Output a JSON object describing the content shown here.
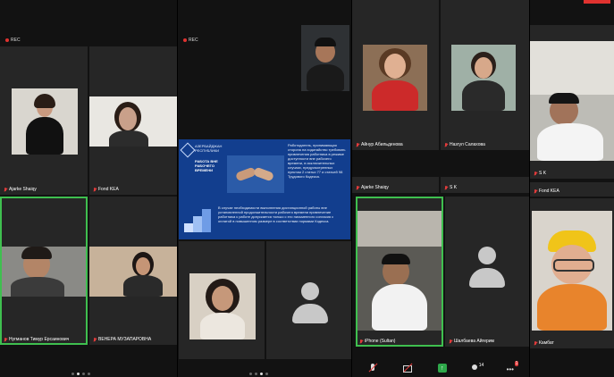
{
  "recording": {
    "label": "REC"
  },
  "panel1": {
    "tiles": [
      {
        "name": "Ajarke Shaiqy"
      },
      {
        "name": "Fond KEA"
      },
      {
        "name": "Нугманов Тимур Ерсаинович"
      },
      {
        "name": "ВЕНЕРА МУЗАПАРОВНА"
      }
    ]
  },
  "panel2": {
    "slide": {
      "logo_text": "АЗЕРБАЙДЖАН\nРЕСПУБЛИКИ",
      "sub_title": "РАБОТА ВНЕ РАБОЧЕГО ВРЕМЕНИ",
      "bullet_top": "Работодатель, принимающая сторона на ходатайство требовать привлечения работника в режиме доступности вне рабочего времени, в исключительных случаях, предусмотренных пунктом 2 статьи 77 и статьей 98 Трудового Кодекса.",
      "bullet_bottom": "В случае необходимости выполнения дистанционной работы вне установленной продолжительности рабочего времени привлечение работника к работе допускается только с его письменного согласия с оплатой в повышенном размере в соответствии нормами Кодекса."
    }
  },
  "panel3": {
    "tiles": [
      {
        "name": "Айнур Абильденова"
      },
      {
        "name": "Назгул Салахова"
      },
      {
        "name": "Ajarke Shaiqy"
      },
      {
        "name": "S K"
      },
      {
        "name": "iPhone (Sultan)"
      },
      {
        "name": "Шалбаева Айгерим"
      }
    ],
    "participants_count": "14",
    "chat_badge": "1"
  },
  "panel4": {
    "tiles": [
      {
        "name": "S K"
      },
      {
        "name": "Fond KEA"
      },
      {
        "name": "Камбат"
      }
    ]
  },
  "colors": {
    "active_outline": "#3fbf4f",
    "slide_bg": "#123e8e",
    "muted_mic": "#e23b3b"
  }
}
